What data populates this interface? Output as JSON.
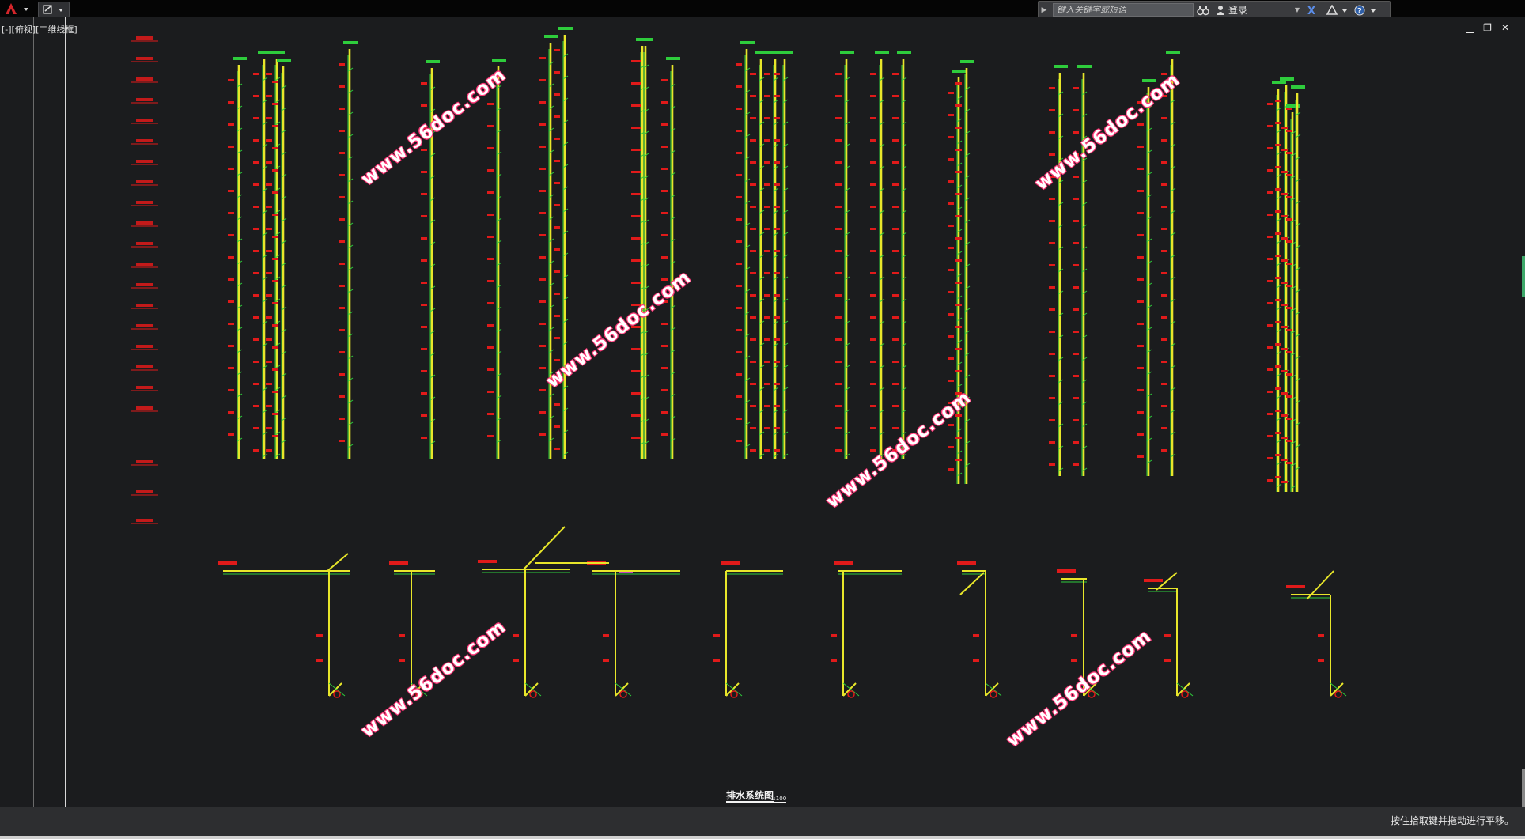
{
  "titlebar": {
    "search_placeholder": "键入关键字或短语",
    "login_label": "登录"
  },
  "viewport": {
    "label": "[-][俯视][二维线框]"
  },
  "drawing": {
    "title": "排水系统图",
    "scale": "1:100",
    "watermark": "www.56doc.com",
    "colors": {
      "background": "#1b1c1e",
      "pipe_main": "#e8e62a",
      "pipe_branch": "#2ecc3c",
      "dimension": "#e01a1a",
      "text": "#f2f2f2"
    }
  },
  "statusbar": {
    "message": "按住拾取键并拖动进行平移。"
  }
}
